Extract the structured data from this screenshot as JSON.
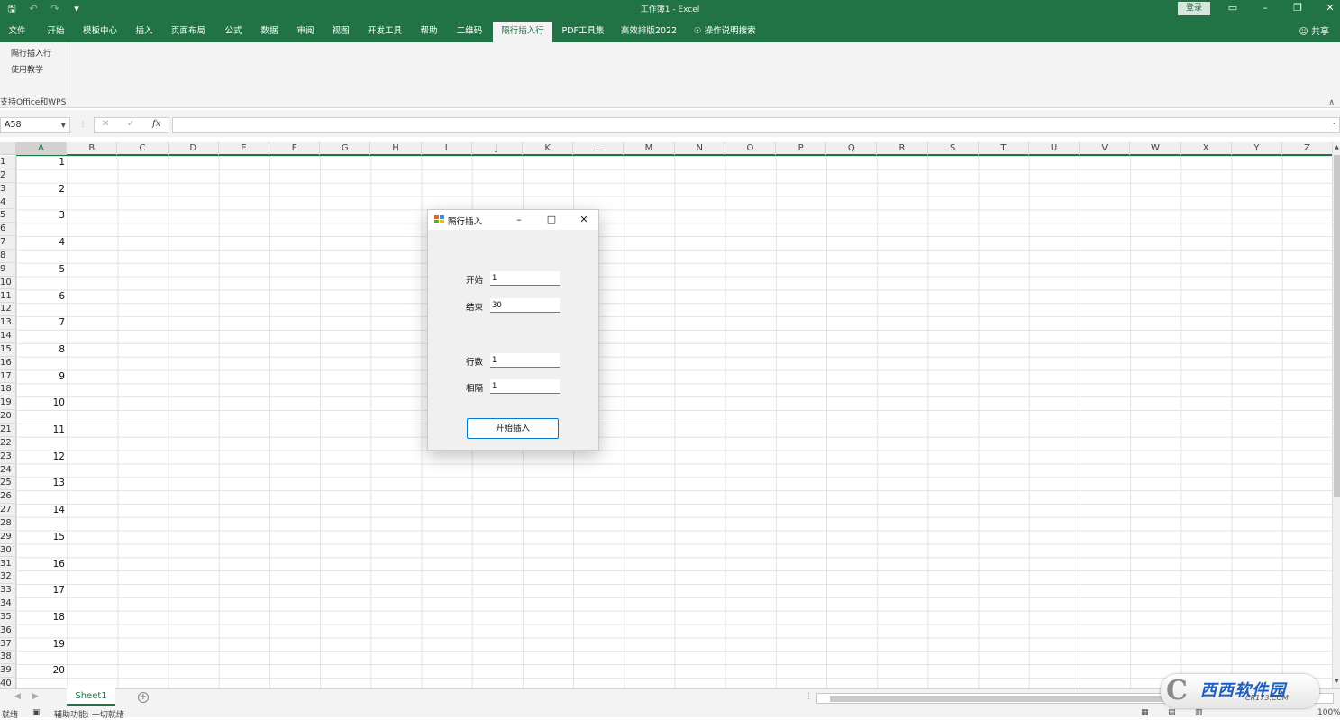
{
  "window": {
    "title": "工作簿1  -  Excel",
    "login_label": "登录",
    "share_label": "共享",
    "colors": {
      "accent": "#217346",
      "ribbon_bg": "#f3f3f3",
      "dialog_border_focus": "#0078d4"
    }
  },
  "qat": {
    "save_icon": "save-icon",
    "undo_icon": "undo-icon",
    "redo_icon": "redo-icon",
    "customize_icon": "customize-qat-icon"
  },
  "tabs": [
    {
      "label": "文件"
    },
    {
      "label": "开始"
    },
    {
      "label": "模板中心"
    },
    {
      "label": "插入"
    },
    {
      "label": "页面布局"
    },
    {
      "label": "公式"
    },
    {
      "label": "数据"
    },
    {
      "label": "审阅"
    },
    {
      "label": "视图"
    },
    {
      "label": "开发工具"
    },
    {
      "label": "帮助"
    },
    {
      "label": "二维码"
    },
    {
      "label": "隔行插入行",
      "active": true
    },
    {
      "label": "PDF工具集"
    },
    {
      "label": "高效排版2022"
    },
    {
      "label": "操作说明搜索"
    }
  ],
  "ribbon": {
    "buttons": [
      "隔行插入行",
      "使用教学"
    ],
    "group_label": "支持Office和WPS"
  },
  "formula_bar": {
    "name_box": "A58",
    "fx_label": "fx",
    "formula": ""
  },
  "grid": {
    "columns": [
      "A",
      "B",
      "C",
      "D",
      "E",
      "F",
      "G",
      "H",
      "I",
      "J",
      "K",
      "L",
      "M",
      "N",
      "O",
      "P",
      "Q",
      "R",
      "S",
      "T",
      "U",
      "V",
      "W",
      "X",
      "Y",
      "Z"
    ],
    "selected_column": "A",
    "rows": [
      "1",
      "2",
      "3",
      "4",
      "5",
      "6",
      "7",
      "8",
      "9",
      "10",
      "11",
      "12",
      "13",
      "14",
      "15",
      "16",
      "17",
      "18",
      "19",
      "20",
      "21",
      "22",
      "23",
      "24",
      "25",
      "26",
      "27",
      "28",
      "29",
      "30",
      "31",
      "32",
      "33",
      "34",
      "35",
      "36",
      "37",
      "38",
      "39",
      "40"
    ],
    "column_a_values": [
      "1",
      "2",
      "3",
      "4",
      "5",
      "6",
      "7",
      "8",
      "9",
      "10",
      "11",
      "12",
      "13",
      "14",
      "15",
      "16",
      "17",
      "18",
      "19",
      "20"
    ]
  },
  "sheets": {
    "tabs": [
      "Sheet1"
    ],
    "add_icon": "add-sheet-icon"
  },
  "status": {
    "ready": "就绪",
    "accessibility": "辅助功能: 一切就绪",
    "zoom": "100%"
  },
  "dialog": {
    "title": "隔行插入",
    "fields": [
      {
        "label": "开始",
        "value": "1"
      },
      {
        "label": "结束",
        "value": "30"
      },
      {
        "label": "行数",
        "value": "1"
      },
      {
        "label": "相隔",
        "value": "1"
      }
    ],
    "submit_label": "开始插入"
  },
  "watermark": {
    "main": "西西软件园",
    "sub": "CR173.COM"
  }
}
